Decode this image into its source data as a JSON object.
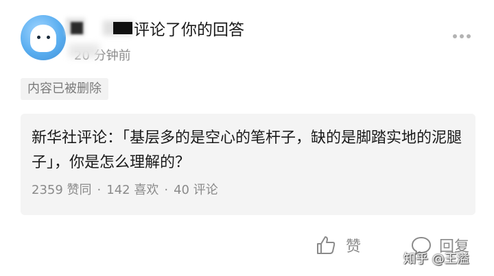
{
  "notification": {
    "headline": "评论了你的回答",
    "time_visible": "20 分钟前",
    "deleted_tag": "内容已被删除"
  },
  "question": {
    "title": "新华社评论：「基层多的是空心的笔杆子，缺的是脚踏实地的泥腿子」，你是怎么理解的？",
    "likes": "2359 赞同",
    "favorites": "142 喜欢",
    "comments": "40 评论",
    "separator": "·"
  },
  "actions": {
    "like_label": "赞",
    "reply_label": "回复"
  },
  "watermark": "知乎 @王溢",
  "icons": {
    "avatar": "avatar",
    "more": "more-icon",
    "like": "thumb-up-icon",
    "reply": "comment-bubble-icon"
  },
  "colors": {
    "text_primary": "#1a1a1a",
    "text_secondary": "#8a8a8a",
    "card_bg": "#f4f4f4",
    "tag_bg": "#f2f2f2"
  }
}
